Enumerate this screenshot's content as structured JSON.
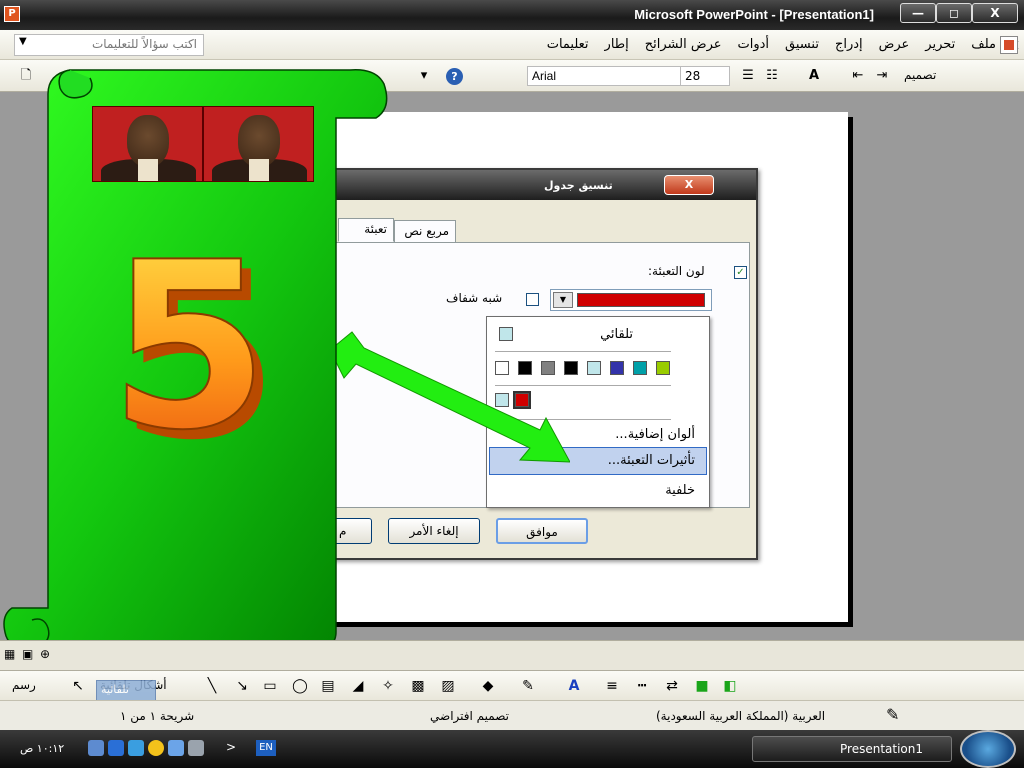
{
  "window": {
    "title": "Microsoft PowerPoint - [Presentation1]",
    "minimize": "—",
    "maximize": "◻",
    "close": "X"
  },
  "menubar": {
    "items": [
      "ملف",
      "تحرير",
      "عرض",
      "إدراج",
      "تنسيق",
      "أدوات",
      "عرض الشرائح",
      "إطار",
      "تعليمات"
    ],
    "close_doc": "×",
    "help_placeholder": "اكتب سؤالاً للتعليمات"
  },
  "toolbar": {
    "font_name": "Arial",
    "font_size": "28",
    "design_label": "تصميم"
  },
  "dialog": {
    "title": "تنسيق جدول",
    "close": "X",
    "tabs": [
      {
        "label": "تعبئة"
      },
      {
        "label": "مربع نص"
      }
    ],
    "fill_color_label": "لون التعبئة:",
    "semi_transparent_label": "شبه شفاف",
    "fill_color_hex": "#d00000",
    "ok_label": "موافق",
    "cancel_label": "إلغاء الأمر",
    "preview_label": "م"
  },
  "dropdown": {
    "automatic": "تلقائي",
    "more_colors": "ألوان إضافية...",
    "fill_effects": "تأثيرات التعبئة...",
    "background": "خلفية",
    "palette": [
      "#ffffff",
      "#000000",
      "#808080",
      "#000000",
      "#c0e6ea",
      "#3333aa",
      "#00a0a8",
      "#99cc00"
    ],
    "recent": [
      "#c0e6ea",
      "#d00000"
    ]
  },
  "slide": {
    "big_number": "5"
  },
  "drawbar": {
    "draw_label": "رسم",
    "shapes_label": "أشكال تلقائية",
    "overlay_label": "تلقائية"
  },
  "status": {
    "slide_info": "شريحة ١ من ١",
    "design": "تصميم افتراضي",
    "language": "العربية (المملكة العربية السعودية)"
  },
  "taskbar": {
    "task_label": "Presentation1",
    "clock": "١٠:١٢ ص",
    "lang": "EN"
  }
}
